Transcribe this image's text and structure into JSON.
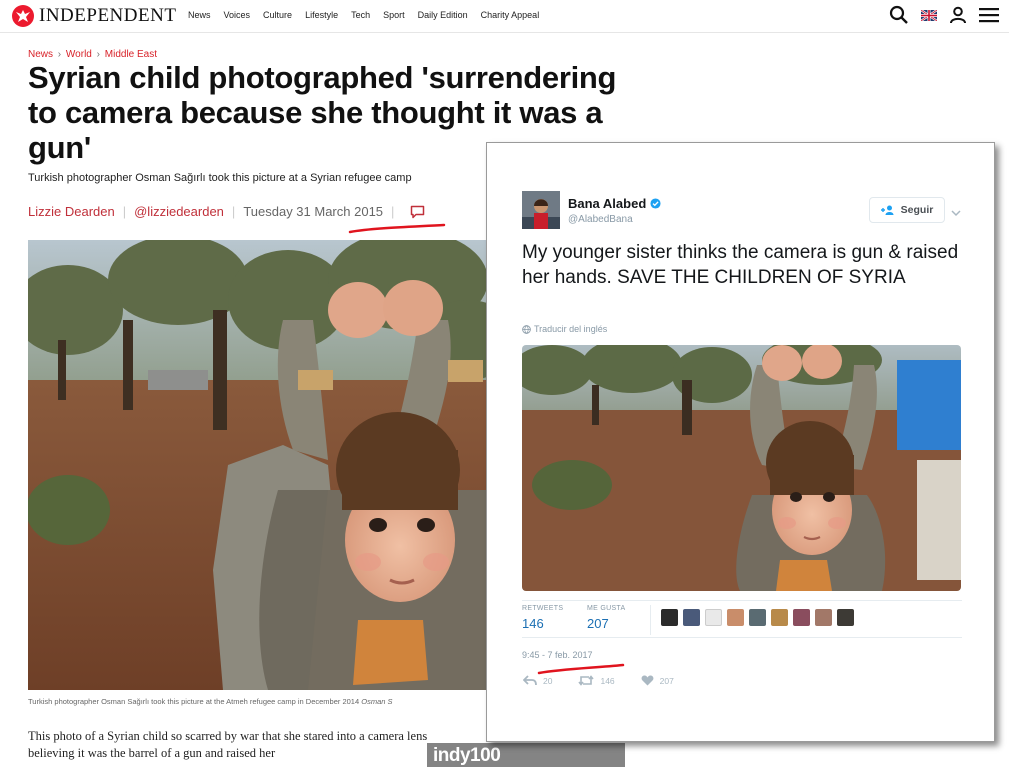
{
  "site": {
    "logo_text": "INDEPENDENT",
    "nav": [
      "News",
      "Voices",
      "Culture",
      "Lifestyle",
      "Tech",
      "Sport",
      "Daily Edition",
      "Charity Appeal"
    ],
    "icons": [
      "search-icon",
      "uk-flag-icon",
      "user-icon",
      "menu-icon"
    ]
  },
  "article": {
    "breadcrumb": [
      "News",
      "World",
      "Middle East"
    ],
    "headline": "Syrian child photographed 'surrendering to camera because she thought it was a gun'",
    "standfirst": "Turkish photographer Osman Sağırlı took this picture at a Syrian refugee camp",
    "author": "Lizzie Dearden",
    "twitter": "@lizziedearden",
    "date": "Tuesday 31 March 2015",
    "caption": "Turkish photographer Osman Sağırlı took this picture at the Atmeh refugee camp in December 2014",
    "caption_credit": "Osman S",
    "body": "This photo of a Syrian child so scarred by war that she stared into a camera lens believing it was the barrel of a gun and raised her",
    "banner": "indy100"
  },
  "tweet": {
    "name": "Bana Alabed",
    "handle": "@AlabedBana",
    "follow_label": "Seguir",
    "text": "My younger sister thinks the camera is gun & raised her hands. SAVE THE CHILDREN OF SYRIA",
    "translate": "Traducir del inglés",
    "retweets_label": "RETWEETS",
    "retweets": "146",
    "likes_label": "ME GUSTA",
    "likes": "207",
    "time": "9:45 - 7 feb. 2017",
    "reply_count": "20",
    "retweet_count": "146",
    "like_count": "207"
  },
  "colors": {
    "brand_red": "#ec1a2e",
    "link_red": "#d8232a",
    "twitter_blue": "#1da1f2",
    "annotation_red": "#e0141e"
  }
}
